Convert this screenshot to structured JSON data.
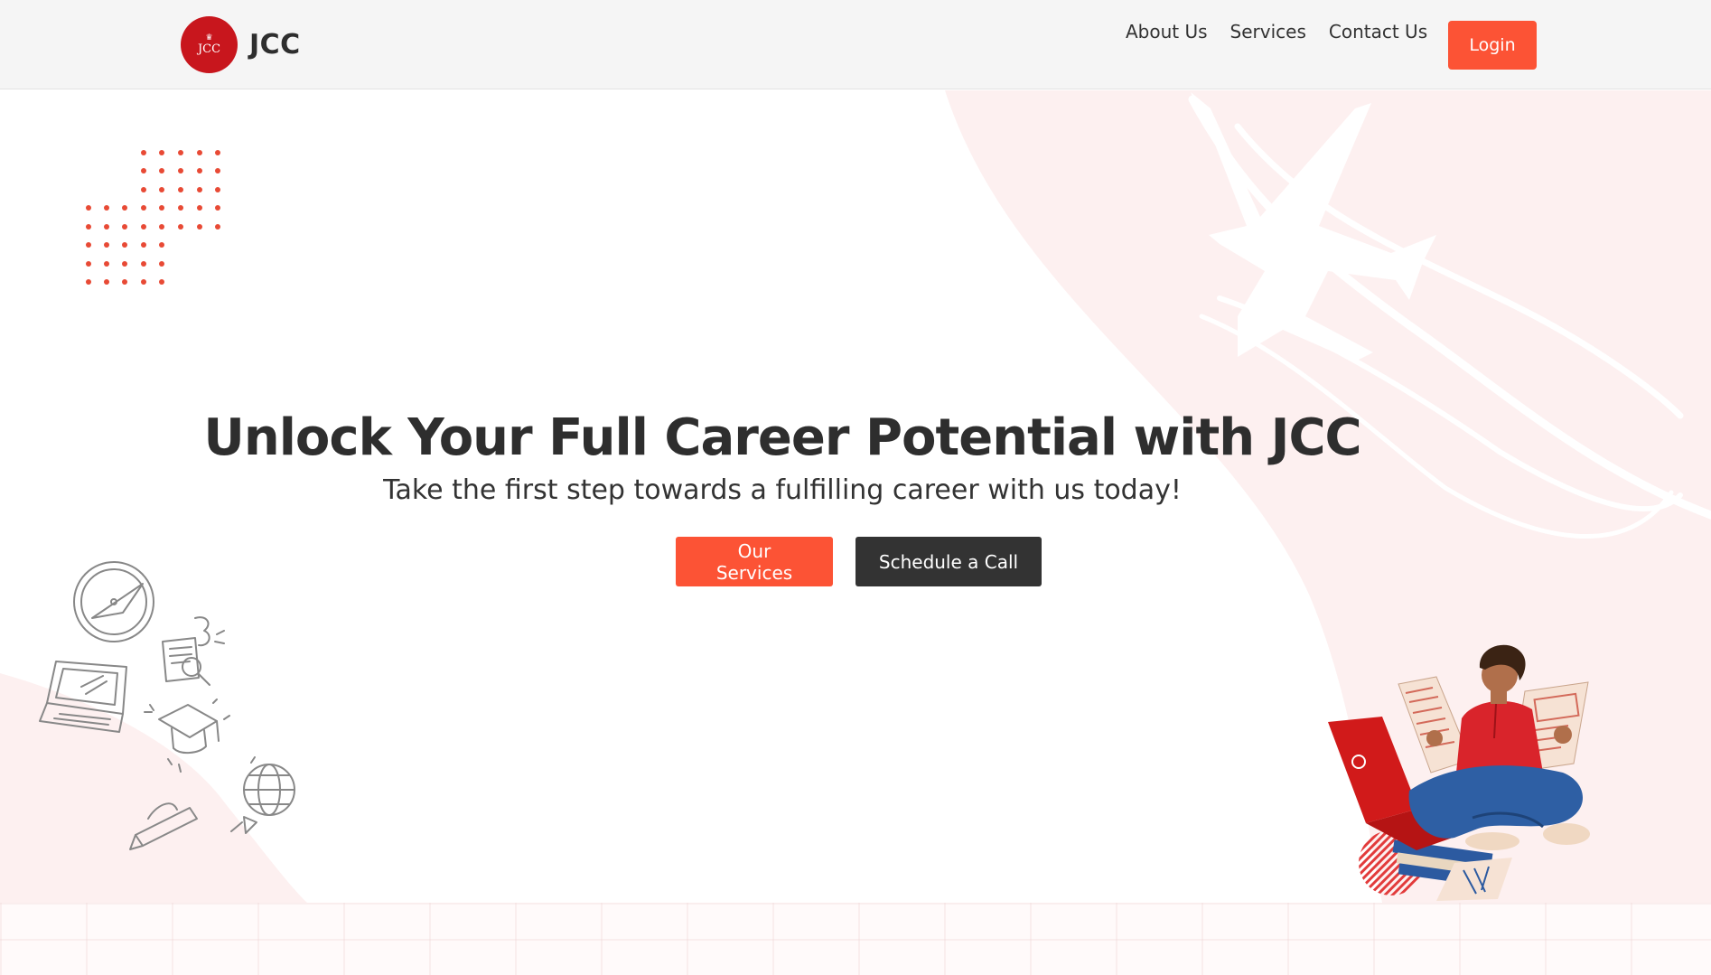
{
  "header": {
    "logo_text": "JCC",
    "brand_name": "JCC",
    "nav": [
      "About Us",
      "Services",
      "Contact Us"
    ],
    "login_label": "Login"
  },
  "hero": {
    "title": "Unlock Your Full Career Potential with JCC",
    "subtitle": "Take the first step towards a fulfilling career with us today!",
    "primary_cta": "Our Services",
    "secondary_cta": "Schedule a Call"
  },
  "colors": {
    "accent": "#fc5335",
    "brand_red": "#c8161d",
    "dark": "#333333",
    "header_bg": "#f5f5f5",
    "blob_bg": "#fdf0f0"
  },
  "icons": [
    "crown-icon",
    "dot-grid-pattern",
    "compass-icon",
    "laptop-icon",
    "graduation-cap-icon",
    "globe-icon",
    "pencil-icon",
    "airplane-icon",
    "student-illustration"
  ]
}
